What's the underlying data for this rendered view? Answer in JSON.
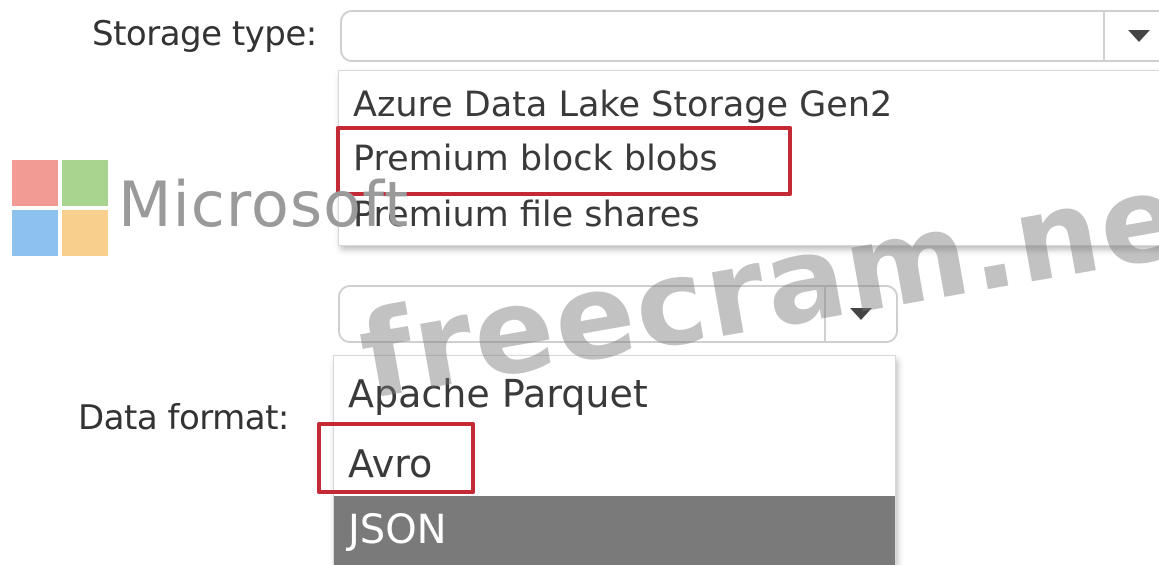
{
  "storage_type": {
    "label": "Storage type:",
    "value": "",
    "options": [
      "Azure Data Lake Storage Gen2",
      "Premium block blobs",
      "Premium file shares"
    ],
    "boxed_option": "Premium block blobs"
  },
  "data_format": {
    "label": "Data format:",
    "value": "",
    "options": [
      "Apache Parquet",
      "Avro",
      "JSON"
    ],
    "boxed_option": "Avro",
    "highlighted_option": "JSON"
  },
  "watermark": {
    "logo_text": "Microsoft",
    "site_text": "freecram.net",
    "logo_colors": [
      "#f29b94",
      "#a8d48f",
      "#8dc2ee",
      "#f8cf8c"
    ]
  },
  "colors": {
    "answer_box": "#c32a36",
    "highlight_bg": "#7a7a7a",
    "border": "#cfcfcf"
  }
}
